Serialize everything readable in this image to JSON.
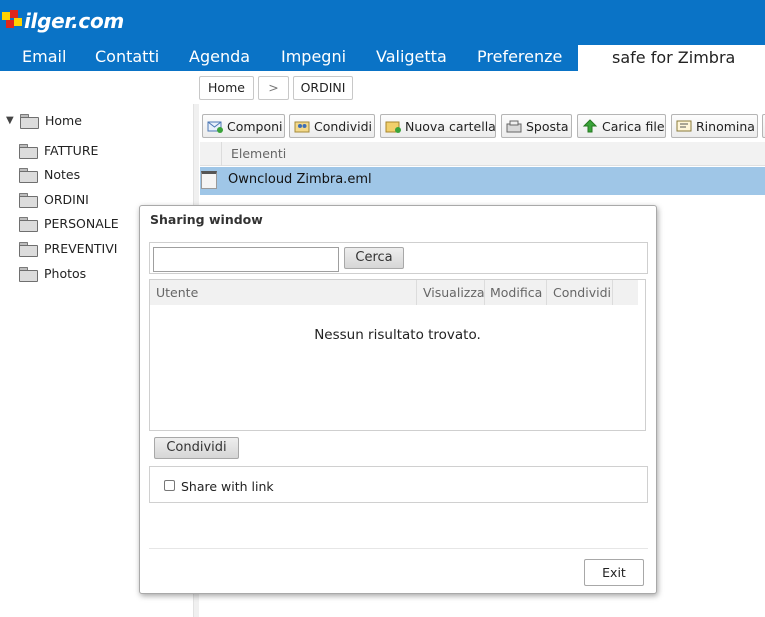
{
  "header": {
    "logo_text": "ilger.com",
    "brand_color": "#0a73c6",
    "nav": [
      "Email",
      "Contatti",
      "Agenda",
      "Impegni",
      "Valigetta",
      "Preferenze"
    ],
    "active_tab": "safe for Zimbra"
  },
  "breadcrumb": [
    "Home",
    ">",
    "ORDINI"
  ],
  "tree": {
    "root": "Home",
    "children": [
      "FATTURE",
      "Notes",
      "ORDINI",
      "PERSONALE",
      "PREVENTIVI",
      "Photos"
    ]
  },
  "toolbar": [
    {
      "label": "Componi",
      "icon": "compose-icon"
    },
    {
      "label": "Condividi",
      "icon": "share-icon"
    },
    {
      "label": "Nuova cartella",
      "icon": "new-folder-icon"
    },
    {
      "label": "Sposta",
      "icon": "move-icon"
    },
    {
      "label": "Carica file",
      "icon": "upload-icon"
    },
    {
      "label": "Rinomina",
      "icon": "rename-icon"
    }
  ],
  "list": {
    "header": "Elementi",
    "rows": [
      "Owncloud Zimbra.eml"
    ],
    "selected_color": "#9fc6e7"
  },
  "dialog": {
    "title": "Sharing window",
    "search_value": "",
    "search_button": "Cerca",
    "columns": [
      "Utente",
      "Visualizza",
      "Modifica",
      "Condividi"
    ],
    "empty_message": "Nessun risultato trovato.",
    "share_button": "Condividi",
    "share_link_label": "Share with link",
    "share_link_checked": false,
    "exit_button": "Exit"
  }
}
